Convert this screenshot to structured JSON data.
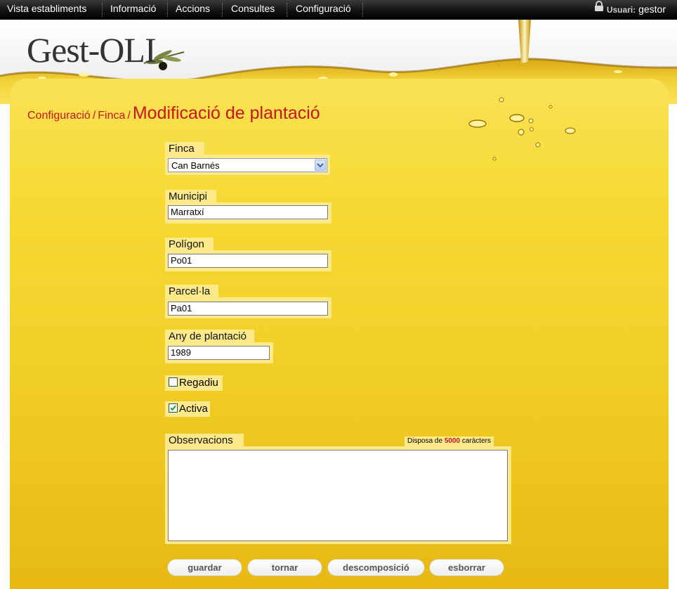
{
  "nav": {
    "items": [
      "Vista establiments",
      "Informació",
      "Accions",
      "Consultes",
      "Configuració"
    ],
    "user_label": "Usuari:",
    "user_name": "gestor"
  },
  "logo": {
    "text": "Gest-OLI"
  },
  "breadcrumb": {
    "items": [
      "Configuració",
      "Finca"
    ],
    "separator": "/",
    "title": "Modificació de plantació"
  },
  "form": {
    "finca": {
      "label": "Finca",
      "value": "Can Barnés"
    },
    "municipi": {
      "label": "Municipi",
      "value": "Marratxí"
    },
    "poligon": {
      "label": "Polígon",
      "value": "Po01"
    },
    "parcela": {
      "label": "Parcel·la",
      "value": "Pa01"
    },
    "any": {
      "label": "Any de plantació",
      "value": "1989"
    },
    "regadiu": {
      "label": "Regadiu",
      "checked": false
    },
    "activa": {
      "label": "Activa",
      "checked": true
    },
    "observacions": {
      "label": "Observacions",
      "value": "",
      "counter_prefix": "Disposa de",
      "counter_value": "5000",
      "counter_suffix": "caràcters"
    }
  },
  "buttons": {
    "save": "guardar",
    "back": "tornar",
    "decompose": "descomposició",
    "delete": "esborrar"
  },
  "colors": {
    "accent": "#c8161c",
    "oil": "#f2d12b",
    "label_bg": "#fbe98a"
  }
}
